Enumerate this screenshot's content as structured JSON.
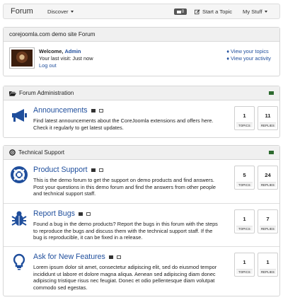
{
  "navbar": {
    "brand": "Forum",
    "discover": "Discover",
    "messages_count": "0",
    "start_topic": "Start a Topic",
    "my_stuff": "My Stuff"
  },
  "welcome_panel": {
    "title": "corejoomla.com demo site Forum",
    "welcome_label": "Welcome,",
    "user_name": "Admin",
    "last_visit": "Your last visit: Just now",
    "logout": "Log out",
    "view_topics": "♦ View your topics",
    "view_activity": "♦ View your activity"
  },
  "sections": [
    {
      "title": "Forum Administration",
      "icon": "folder-open-icon",
      "categories": [
        {
          "title": "Announcements",
          "icon": "bullhorn-icon",
          "description": "Find latest announcements about the CoreJoomla extensions and offers here. Check it regularly to get latest updates.",
          "topics": "1",
          "replies": "11"
        }
      ]
    },
    {
      "title": "Technical Support",
      "icon": "life-ring-icon",
      "categories": [
        {
          "title": "Product Support",
          "icon": "life-ring-icon",
          "description": "This is the demo forum to get the support on demo products and find answers. Post your questions in this demo forum and find the answers from other people and technical support staff.",
          "topics": "5",
          "replies": "24"
        },
        {
          "title": "Report Bugs",
          "icon": "bug-icon",
          "description": "Found a bug in the demo products? Report the bugs in this forum with the steps to reproduce the bugs and discuss them with the technical support staff. If the bug is reproducible, it can be fixed in a release.",
          "topics": "1",
          "replies": "7"
        },
        {
          "title": "Ask for New Features",
          "icon": "lightbulb-icon",
          "description": "Lorem ipsum dolor sit amet, consectetur adipiscing elit, sed do eiusmod tempor incididunt ut labore et dolore magna aliqua. Aenean sed adipiscing diam donec adipiscing tristique risus nec feugiat. Donec et odio pellentesque diam volutpat commodo sed egestas.",
          "topics": "1",
          "replies": "1"
        }
      ]
    }
  ],
  "labels": {
    "topics": "TOPICS",
    "replies": "REPLIES"
  },
  "colors": {
    "link": "#1f4e9c",
    "icon_blue": "#1f4e9c",
    "rss_green": "#2d6a2f"
  }
}
